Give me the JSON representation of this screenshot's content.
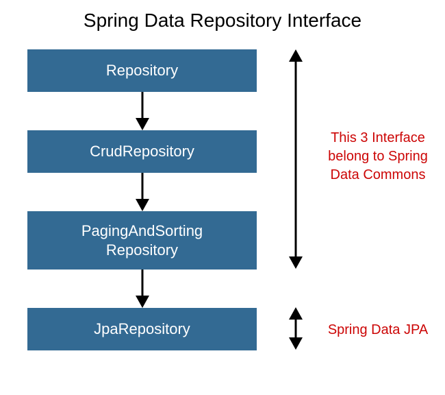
{
  "title": "Spring Data Repository Interface",
  "boxes": {
    "b1": "Repository",
    "b2": "CrudRepository",
    "b3_line1": "PagingAndSorting",
    "b3_line2": "Repository",
    "b4": "JpaRepository"
  },
  "annotations": {
    "group1_line1": "This 3 Interface",
    "group1_line2": "belong to Spring",
    "group1_line3": "Data Commons",
    "group2": "Spring Data JPA"
  },
  "colors": {
    "box_bg": "#336a93",
    "box_text": "#ffffff",
    "annotation_text": "#cc0505",
    "arrow": "#000000"
  }
}
